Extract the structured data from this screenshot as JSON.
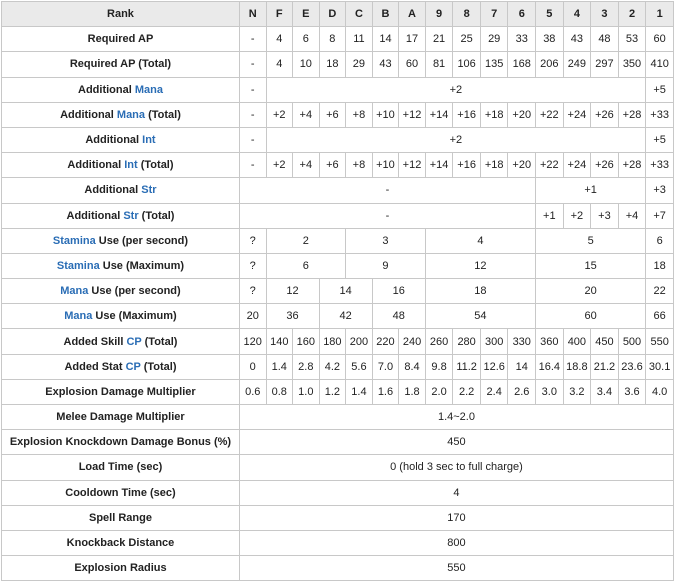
{
  "header": {
    "label": "Rank",
    "ranks": [
      "N",
      "F",
      "E",
      "D",
      "C",
      "B",
      "A",
      "9",
      "8",
      "7",
      "6",
      "5",
      "4",
      "3",
      "2",
      "1"
    ]
  },
  "rows": [
    {
      "label": [
        "Required AP"
      ],
      "cells": [
        {
          "v": "-",
          "span": 1
        },
        {
          "v": "4",
          "span": 1
        },
        {
          "v": "6",
          "span": 1
        },
        {
          "v": "8",
          "span": 1
        },
        {
          "v": "11",
          "span": 1
        },
        {
          "v": "14",
          "span": 1
        },
        {
          "v": "17",
          "span": 1
        },
        {
          "v": "21",
          "span": 1
        },
        {
          "v": "25",
          "span": 1
        },
        {
          "v": "29",
          "span": 1
        },
        {
          "v": "33",
          "span": 1
        },
        {
          "v": "38",
          "span": 1
        },
        {
          "v": "43",
          "span": 1
        },
        {
          "v": "48",
          "span": 1
        },
        {
          "v": "53",
          "span": 1
        },
        {
          "v": "60",
          "span": 1
        }
      ]
    },
    {
      "label": [
        "Required AP (Total)"
      ],
      "cells": [
        {
          "v": "-",
          "span": 1
        },
        {
          "v": "4",
          "span": 1
        },
        {
          "v": "10",
          "span": 1
        },
        {
          "v": "18",
          "span": 1
        },
        {
          "v": "29",
          "span": 1
        },
        {
          "v": "43",
          "span": 1
        },
        {
          "v": "60",
          "span": 1
        },
        {
          "v": "81",
          "span": 1
        },
        {
          "v": "106",
          "span": 1
        },
        {
          "v": "135",
          "span": 1
        },
        {
          "v": "168",
          "span": 1
        },
        {
          "v": "206",
          "span": 1
        },
        {
          "v": "249",
          "span": 1
        },
        {
          "v": "297",
          "span": 1
        },
        {
          "v": "350",
          "span": 1
        },
        {
          "v": "410",
          "span": 1
        }
      ]
    },
    {
      "label": [
        "Additional ",
        "Mana",
        ""
      ],
      "cells": [
        {
          "v": "-",
          "span": 1
        },
        {
          "v": "+2",
          "span": 14
        },
        {
          "v": "+5",
          "span": 1
        }
      ]
    },
    {
      "label": [
        "Additional ",
        "Mana",
        " (Total)"
      ],
      "cells": [
        {
          "v": "-",
          "span": 1
        },
        {
          "v": "+2",
          "span": 1
        },
        {
          "v": "+4",
          "span": 1
        },
        {
          "v": "+6",
          "span": 1
        },
        {
          "v": "+8",
          "span": 1
        },
        {
          "v": "+10",
          "span": 1
        },
        {
          "v": "+12",
          "span": 1
        },
        {
          "v": "+14",
          "span": 1
        },
        {
          "v": "+16",
          "span": 1
        },
        {
          "v": "+18",
          "span": 1
        },
        {
          "v": "+20",
          "span": 1
        },
        {
          "v": "+22",
          "span": 1
        },
        {
          "v": "+24",
          "span": 1
        },
        {
          "v": "+26",
          "span": 1
        },
        {
          "v": "+28",
          "span": 1
        },
        {
          "v": "+33",
          "span": 1
        }
      ]
    },
    {
      "label": [
        "Additional ",
        "Int",
        ""
      ],
      "cells": [
        {
          "v": "-",
          "span": 1
        },
        {
          "v": "+2",
          "span": 14
        },
        {
          "v": "+5",
          "span": 1
        }
      ]
    },
    {
      "label": [
        "Additional ",
        "Int",
        " (Total)"
      ],
      "cells": [
        {
          "v": "-",
          "span": 1
        },
        {
          "v": "+2",
          "span": 1
        },
        {
          "v": "+4",
          "span": 1
        },
        {
          "v": "+6",
          "span": 1
        },
        {
          "v": "+8",
          "span": 1
        },
        {
          "v": "+10",
          "span": 1
        },
        {
          "v": "+12",
          "span": 1
        },
        {
          "v": "+14",
          "span": 1
        },
        {
          "v": "+16",
          "span": 1
        },
        {
          "v": "+18",
          "span": 1
        },
        {
          "v": "+20",
          "span": 1
        },
        {
          "v": "+22",
          "span": 1
        },
        {
          "v": "+24",
          "span": 1
        },
        {
          "v": "+26",
          "span": 1
        },
        {
          "v": "+28",
          "span": 1
        },
        {
          "v": "+33",
          "span": 1
        }
      ]
    },
    {
      "label": [
        "Additional ",
        "Str",
        ""
      ],
      "cells": [
        {
          "v": "-",
          "span": 11
        },
        {
          "v": "+1",
          "span": 4
        },
        {
          "v": "+3",
          "span": 1
        }
      ]
    },
    {
      "label": [
        "Additional ",
        "Str",
        " (Total)"
      ],
      "cells": [
        {
          "v": "-",
          "span": 11
        },
        {
          "v": "+1",
          "span": 1
        },
        {
          "v": "+2",
          "span": 1
        },
        {
          "v": "+3",
          "span": 1
        },
        {
          "v": "+4",
          "span": 1
        },
        {
          "v": "+7",
          "span": 1
        }
      ]
    },
    {
      "label": [
        "",
        "Stamina",
        " Use (per second)"
      ],
      "cells": [
        {
          "v": "?",
          "span": 1
        },
        {
          "v": "2",
          "span": 3
        },
        {
          "v": "3",
          "span": 3
        },
        {
          "v": "4",
          "span": 4
        },
        {
          "v": "5",
          "span": 4
        },
        {
          "v": "6",
          "span": 1
        }
      ]
    },
    {
      "label": [
        "",
        "Stamina",
        " Use (Maximum)"
      ],
      "cells": [
        {
          "v": "?",
          "span": 1
        },
        {
          "v": "6",
          "span": 3
        },
        {
          "v": "9",
          "span": 3
        },
        {
          "v": "12",
          "span": 4
        },
        {
          "v": "15",
          "span": 4
        },
        {
          "v": "18",
          "span": 1
        }
      ]
    },
    {
      "label": [
        "",
        "Mana",
        " Use (per second)"
      ],
      "cells": [
        {
          "v": "?",
          "span": 1
        },
        {
          "v": "12",
          "span": 2
        },
        {
          "v": "14",
          "span": 2
        },
        {
          "v": "16",
          "span": 2
        },
        {
          "v": "18",
          "span": 4
        },
        {
          "v": "20",
          "span": 4
        },
        {
          "v": "22",
          "span": 1
        }
      ]
    },
    {
      "label": [
        "",
        "Mana",
        " Use (Maximum)"
      ],
      "cells": [
        {
          "v": "20",
          "span": 1
        },
        {
          "v": "36",
          "span": 2
        },
        {
          "v": "42",
          "span": 2
        },
        {
          "v": "48",
          "span": 2
        },
        {
          "v": "54",
          "span": 4
        },
        {
          "v": "60",
          "span": 4
        },
        {
          "v": "66",
          "span": 1
        }
      ]
    },
    {
      "label": [
        "Added Skill ",
        "CP",
        " (Total)"
      ],
      "cells": [
        {
          "v": "120",
          "span": 1
        },
        {
          "v": "140",
          "span": 1
        },
        {
          "v": "160",
          "span": 1
        },
        {
          "v": "180",
          "span": 1
        },
        {
          "v": "200",
          "span": 1
        },
        {
          "v": "220",
          "span": 1
        },
        {
          "v": "240",
          "span": 1
        },
        {
          "v": "260",
          "span": 1
        },
        {
          "v": "280",
          "span": 1
        },
        {
          "v": "300",
          "span": 1
        },
        {
          "v": "330",
          "span": 1
        },
        {
          "v": "360",
          "span": 1
        },
        {
          "v": "400",
          "span": 1
        },
        {
          "v": "450",
          "span": 1
        },
        {
          "v": "500",
          "span": 1
        },
        {
          "v": "550",
          "span": 1
        }
      ]
    },
    {
      "label": [
        "Added Stat ",
        "CP",
        " (Total)"
      ],
      "cells": [
        {
          "v": "0",
          "span": 1
        },
        {
          "v": "1.4",
          "span": 1
        },
        {
          "v": "2.8",
          "span": 1
        },
        {
          "v": "4.2",
          "span": 1
        },
        {
          "v": "5.6",
          "span": 1
        },
        {
          "v": "7.0",
          "span": 1
        },
        {
          "v": "8.4",
          "span": 1
        },
        {
          "v": "9.8",
          "span": 1
        },
        {
          "v": "11.2",
          "span": 1
        },
        {
          "v": "12.6",
          "span": 1
        },
        {
          "v": "14",
          "span": 1
        },
        {
          "v": "16.4",
          "span": 1
        },
        {
          "v": "18.8",
          "span": 1
        },
        {
          "v": "21.2",
          "span": 1
        },
        {
          "v": "23.6",
          "span": 1
        },
        {
          "v": "30.1",
          "span": 1
        }
      ]
    },
    {
      "label": [
        "Explosion Damage Multiplier"
      ],
      "cells": [
        {
          "v": "0.6",
          "span": 1
        },
        {
          "v": "0.8",
          "span": 1
        },
        {
          "v": "1.0",
          "span": 1
        },
        {
          "v": "1.2",
          "span": 1
        },
        {
          "v": "1.4",
          "span": 1
        },
        {
          "v": "1.6",
          "span": 1
        },
        {
          "v": "1.8",
          "span": 1
        },
        {
          "v": "2.0",
          "span": 1
        },
        {
          "v": "2.2",
          "span": 1
        },
        {
          "v": "2.4",
          "span": 1
        },
        {
          "v": "2.6",
          "span": 1
        },
        {
          "v": "3.0",
          "span": 1
        },
        {
          "v": "3.2",
          "span": 1
        },
        {
          "v": "3.4",
          "span": 1
        },
        {
          "v": "3.6",
          "span": 1
        },
        {
          "v": "4.0",
          "span": 1
        }
      ]
    },
    {
      "label": [
        "Melee Damage Multiplier"
      ],
      "cells": [
        {
          "v": "1.4~2.0",
          "span": 16
        }
      ]
    },
    {
      "label": [
        "Explosion Knockdown Damage Bonus (%)"
      ],
      "cells": [
        {
          "v": "450",
          "span": 16
        }
      ]
    },
    {
      "label": [
        "Load Time (sec)"
      ],
      "cells": [
        {
          "v": "0 (hold 3 sec to full charge)",
          "span": 16
        }
      ]
    },
    {
      "label": [
        "Cooldown Time (sec)"
      ],
      "cells": [
        {
          "v": "4",
          "span": 16
        }
      ]
    },
    {
      "label": [
        "Spell Range"
      ],
      "cells": [
        {
          "v": "170",
          "span": 16
        }
      ]
    },
    {
      "label": [
        "Knockback Distance"
      ],
      "cells": [
        {
          "v": "800",
          "span": 16
        }
      ]
    },
    {
      "label": [
        "Explosion Radius"
      ],
      "cells": [
        {
          "v": "550",
          "span": 16
        }
      ]
    }
  ]
}
